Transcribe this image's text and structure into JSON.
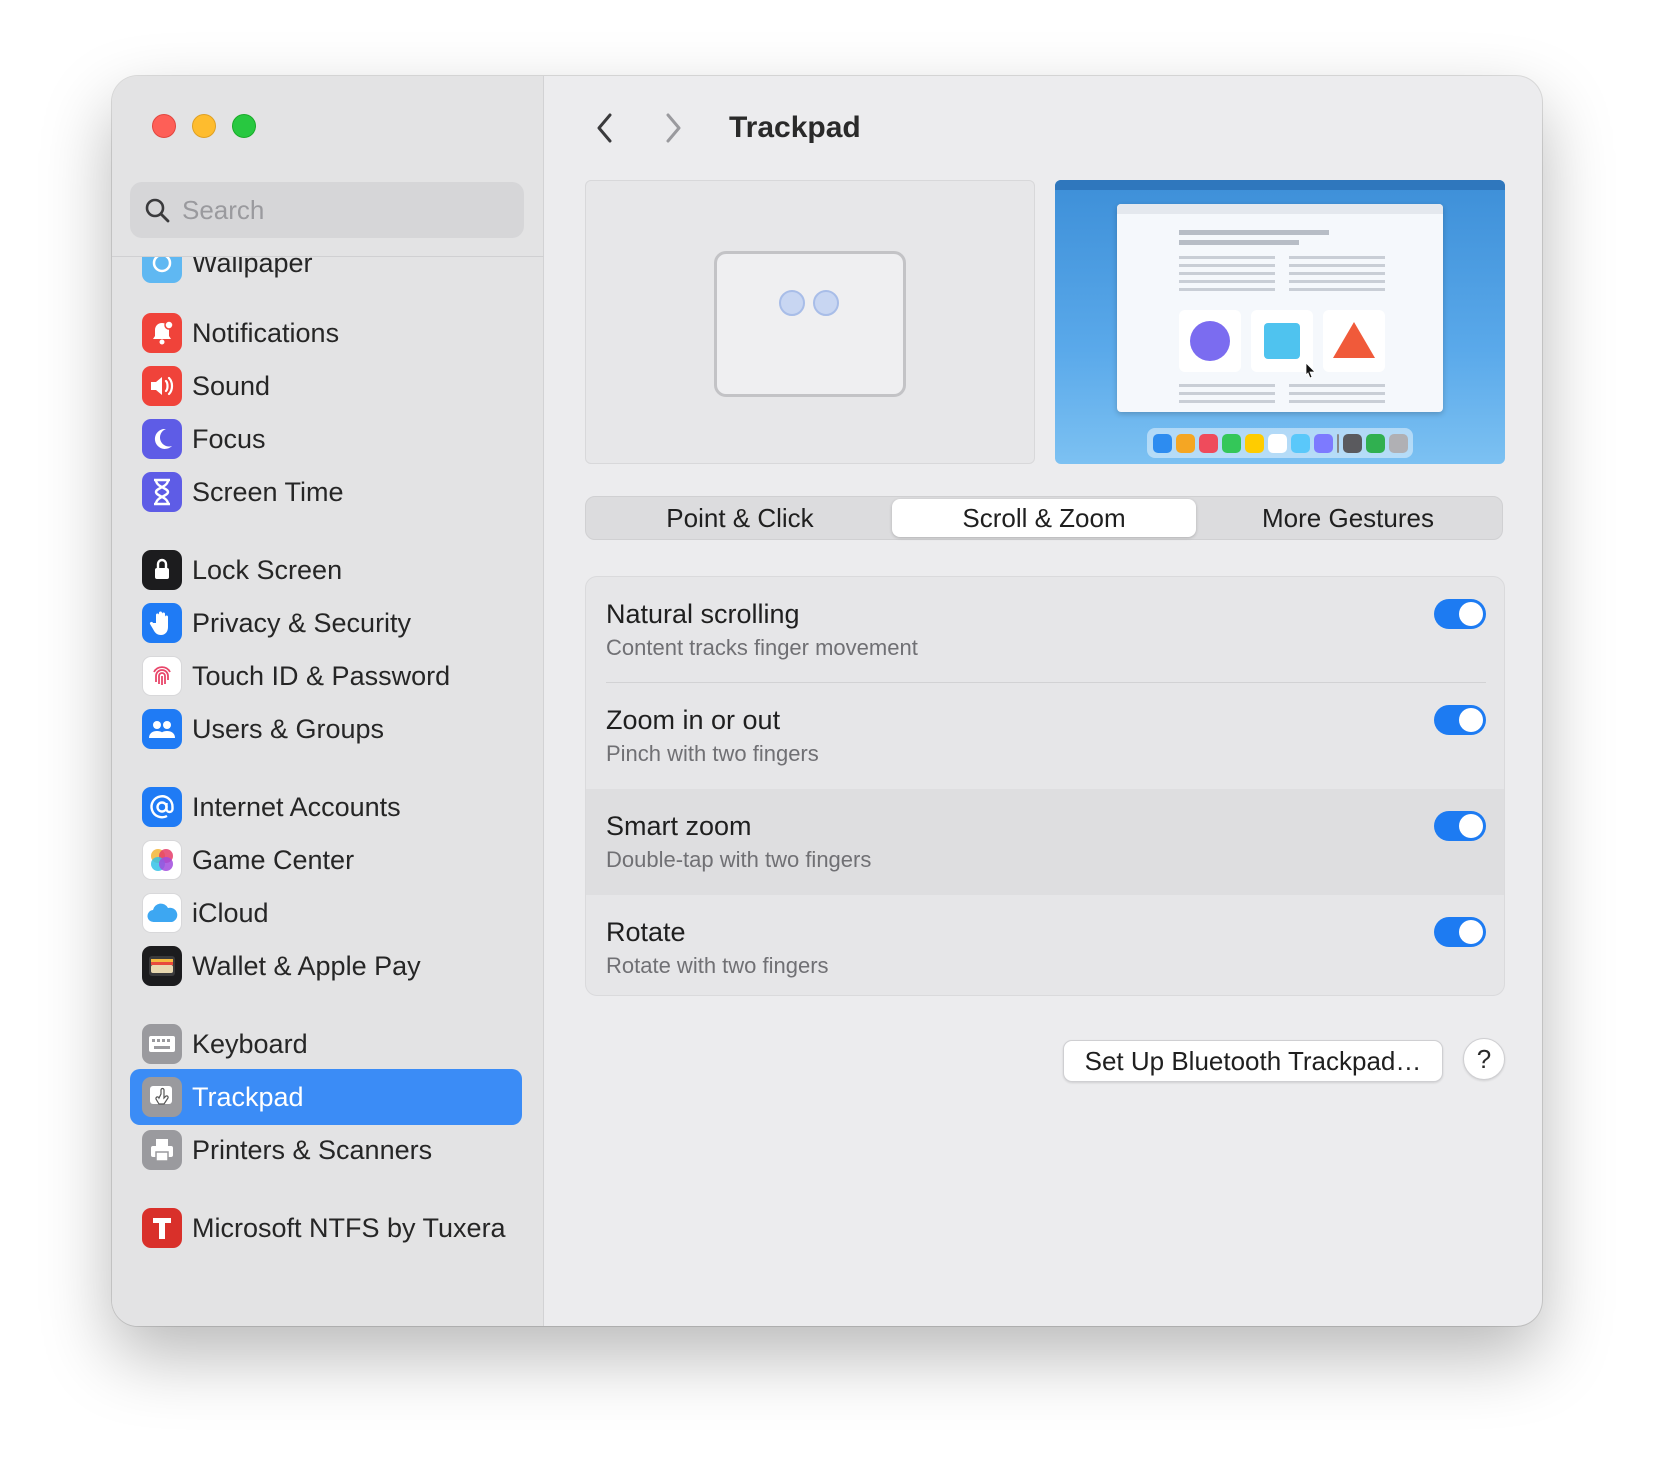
{
  "window": {
    "title": "Trackpad"
  },
  "search": {
    "placeholder": "Search"
  },
  "sidebar": {
    "partial_item": "Wallpaper",
    "items": [
      {
        "label": "Notifications",
        "icon": "bell-icon",
        "color": "#f0433a"
      },
      {
        "label": "Sound",
        "icon": "speaker-icon",
        "color": "#f0433a"
      },
      {
        "label": "Focus",
        "icon": "moon-icon",
        "color": "#5e5ce6"
      },
      {
        "label": "Screen Time",
        "icon": "hourglass-icon",
        "color": "#5e5ce6"
      },
      {
        "label": "Lock Screen",
        "icon": "lock-icon",
        "color": "#1c1c1e"
      },
      {
        "label": "Privacy & Security",
        "icon": "hand-icon",
        "color": "#1f7bf5"
      },
      {
        "label": "Touch ID & Password",
        "icon": "fingerprint-icon",
        "color": "#ffffff"
      },
      {
        "label": "Users & Groups",
        "icon": "users-icon",
        "color": "#1f7bf5"
      },
      {
        "label": "Internet Accounts",
        "icon": "at-icon",
        "color": "#1f7bf5"
      },
      {
        "label": "Game Center",
        "icon": "game-center-icon",
        "color": "#ffffff"
      },
      {
        "label": "iCloud",
        "icon": "cloud-icon",
        "color": "#ffffff"
      },
      {
        "label": "Wallet & Apple Pay",
        "icon": "wallet-icon",
        "color": "#1c1c1e"
      },
      {
        "label": "Keyboard",
        "icon": "keyboard-icon",
        "color": "#9a9a9e"
      },
      {
        "label": "Trackpad",
        "icon": "trackpad-icon",
        "color": "#9a9a9e",
        "selected": true
      },
      {
        "label": "Printers & Scanners",
        "icon": "printer-icon",
        "color": "#9a9a9e"
      },
      {
        "label": "Microsoft NTFS by Tuxera",
        "icon": "tuxera-icon",
        "color": "#d9302a"
      }
    ]
  },
  "tabs": {
    "point_click": "Point & Click",
    "scroll_zoom": "Scroll & Zoom",
    "more_gestures": "More Gestures",
    "selected": "Scroll & Zoom"
  },
  "settings": [
    {
      "title": "Natural scrolling",
      "subtitle": "Content tracks finger movement",
      "enabled": true
    },
    {
      "title": "Zoom in or out",
      "subtitle": "Pinch with two fingers",
      "enabled": true
    },
    {
      "title": "Smart zoom",
      "subtitle": "Double-tap with two fingers",
      "enabled": true
    },
    {
      "title": "Rotate",
      "subtitle": "Rotate with two fingers",
      "enabled": true
    }
  ],
  "buttons": {
    "bluetooth": "Set Up Bluetooth Trackpad…",
    "help": "?"
  },
  "colors": {
    "accent": "#1d7bf2",
    "selection": "#3b8cf6"
  }
}
